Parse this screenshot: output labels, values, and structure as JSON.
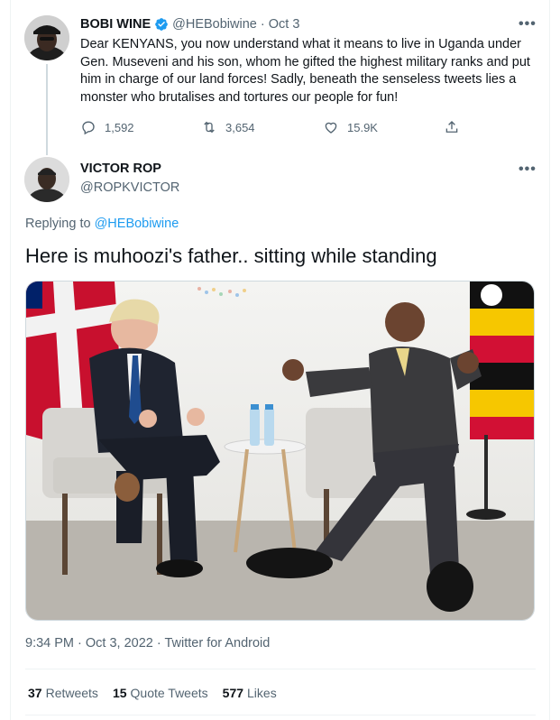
{
  "parent_tweet": {
    "author_name": "BOBI WINE",
    "author_handle": "@HEBobiwine",
    "date": "Oct 3",
    "text": "Dear KENYANS, you now understand what it means to live in Uganda under Gen. Museveni and his son, whom he gifted the highest military ranks and put him in charge of our land forces! Sadly, beneath the senseless tweets lies a monster who brutalises and tortures our people for fun!",
    "replies": "1,592",
    "retweets": "3,654",
    "likes": "15.9K",
    "more": "•••"
  },
  "main_tweet": {
    "author_name": "VICTOR ROP",
    "author_handle": "@ROPKVICTOR",
    "replying_to_label": "Replying to",
    "replying_to_handle": "@HEBobiwine",
    "text": "Here is muhoozi's father.. sitting while standing",
    "timestamp": "9:34 PM · Oct 3, 2022 · Twitter for Android",
    "more": "•••"
  },
  "stats": {
    "retweets_count": "37",
    "retweets_label": "Retweets",
    "quotes_count": "15",
    "quotes_label": "Quote Tweets",
    "likes_count": "577",
    "likes_label": "Likes"
  },
  "colors": {
    "accent": "#1d9bf0",
    "muted": "#536471",
    "text": "#0f1419",
    "border": "#eff3f4"
  },
  "icons": [
    "reply-icon",
    "retweet-icon",
    "like-icon",
    "share-icon",
    "verified-badge-icon",
    "more-icon"
  ]
}
